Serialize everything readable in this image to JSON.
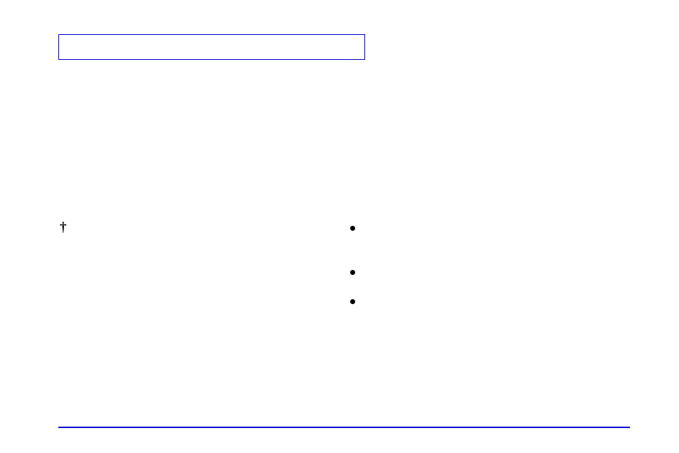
{
  "title_box": "",
  "dagger": "†",
  "bullets": [
    "",
    "",
    ""
  ]
}
